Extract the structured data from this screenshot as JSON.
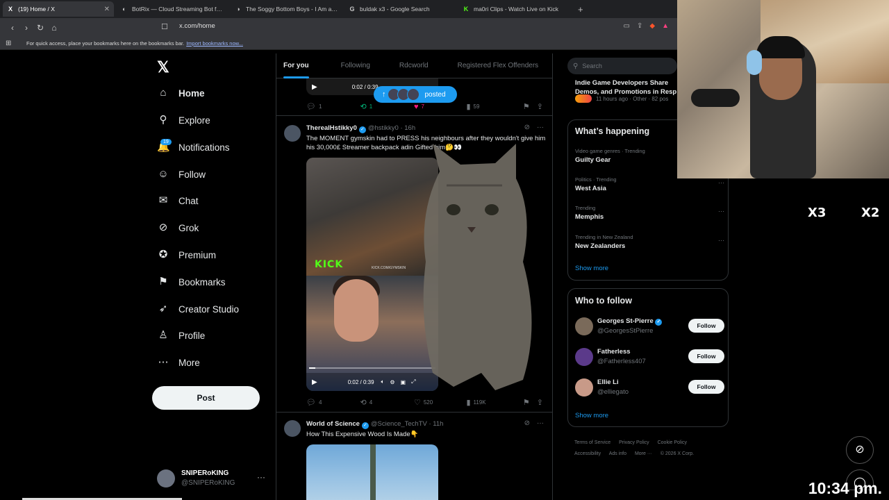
{
  "browser": {
    "tabs": [
      {
        "label": "(19) Home / X",
        "fav": "X",
        "active": true
      },
      {
        "label": "BotRix — Cloud Streaming Bot for Tw",
        "fav": "◐",
        "active": false
      },
      {
        "label": "The Soggy Bottom Boys - I Am a Ma",
        "fav": "◑",
        "active": false
      },
      {
        "label": "buldak x3 - Google Search",
        "fav": "G",
        "active": false
      },
      {
        "label": "ma0ri Clips - Watch Live on Kick",
        "fav": "K",
        "active": false
      }
    ],
    "url": "x.com/home",
    "bookmarks_text": "For quick access, place your bookmarks here on the bookmarks bar.",
    "bookmarks_link": "Import bookmarks now..."
  },
  "nav": {
    "items": [
      {
        "label": "Home",
        "icon": "home-icon",
        "glyph": "⌂"
      },
      {
        "label": "Explore",
        "icon": "search-icon",
        "glyph": "⚲"
      },
      {
        "label": "Notifications",
        "icon": "bell-icon",
        "glyph": "🔔"
      },
      {
        "label": "Follow",
        "icon": "person-add-icon",
        "glyph": "☺"
      },
      {
        "label": "Chat",
        "icon": "mail-icon",
        "glyph": "✉"
      },
      {
        "label": "Grok",
        "icon": "grok-icon",
        "glyph": "⊘"
      },
      {
        "label": "Premium",
        "icon": "verified-icon",
        "glyph": "✪"
      },
      {
        "label": "Bookmarks",
        "icon": "bookmark-icon",
        "glyph": "⚑"
      },
      {
        "label": "Creator Studio",
        "icon": "rocket-icon",
        "glyph": "➶"
      },
      {
        "label": "Profile",
        "icon": "person-icon",
        "glyph": "♙"
      },
      {
        "label": "More",
        "icon": "more-circle-icon",
        "glyph": "⋯"
      }
    ],
    "notification_count": "19",
    "post_label": "Post",
    "profile_name": "SNIPERoKING",
    "profile_handle": "@SNIPERoKING"
  },
  "feed": {
    "tabs": [
      "For you",
      "Following",
      "Rdcworld",
      "Registered Flex Offenders"
    ],
    "posted_label": "posted",
    "top_video_time": "0:02 / 0:39",
    "top_actions": {
      "replies": "1",
      "reposts": "1",
      "likes": "7",
      "views": "59"
    },
    "tweet1": {
      "name": "TherealHstikky0",
      "handle": "@hstikky0 · 16h",
      "text": "The MOMENT gymskin had to PRESS his neighbours after they wouldn't give him his 30,000£ Streamer backpack adin Gifted him🤔👀",
      "kick_text": "KICK",
      "kick_url": "KICK.COM/GYMSKIN",
      "video_time": "0:02 / 0:39",
      "progress": 0.05,
      "replies": "4",
      "reposts": "4",
      "likes": "520",
      "views": "119K"
    },
    "tweet2": {
      "name": "World of Science",
      "handle": "@Science_TechTV · 11h",
      "text": "How This Expensive Wood Is Made👇"
    }
  },
  "sidebar": {
    "search_placeholder": "Search",
    "top_title": "Indie Game Developers Share Demos, and Promotions in Resp",
    "top_meta": "11 hours ago · Other · 82 pos",
    "happening_title": "What’s happening",
    "trends": [
      {
        "category": "Video game genres · Trending",
        "title": "Guilty Gear"
      },
      {
        "category": "Politics · Trending",
        "title": "West Asia"
      },
      {
        "category": "Trending",
        "title": "Memphis"
      },
      {
        "category": "Trending in New Zealand",
        "title": "New Zealanders"
      }
    ],
    "show_more": "Show more",
    "wtf_title": "Who to follow",
    "follow_label": "Follow",
    "who_to_follow": [
      {
        "name": "Georges St-Pierre",
        "handle": "@GeorgesStPierre",
        "verified": true
      },
      {
        "name": "Fatherless",
        "handle": "@Fatherless407",
        "verified": false
      },
      {
        "name": "Ellie Li",
        "handle": "@elliegato",
        "verified": false
      }
    ],
    "footer": [
      "Terms of Service",
      "Privacy Policy",
      "Cookie Policy",
      "Accessibility",
      "Ads info",
      "More ···",
      "© 2026 X Corp."
    ]
  },
  "overlay": {
    "x3": "X3",
    "x2": "X2",
    "clock": "10:34 pm."
  }
}
